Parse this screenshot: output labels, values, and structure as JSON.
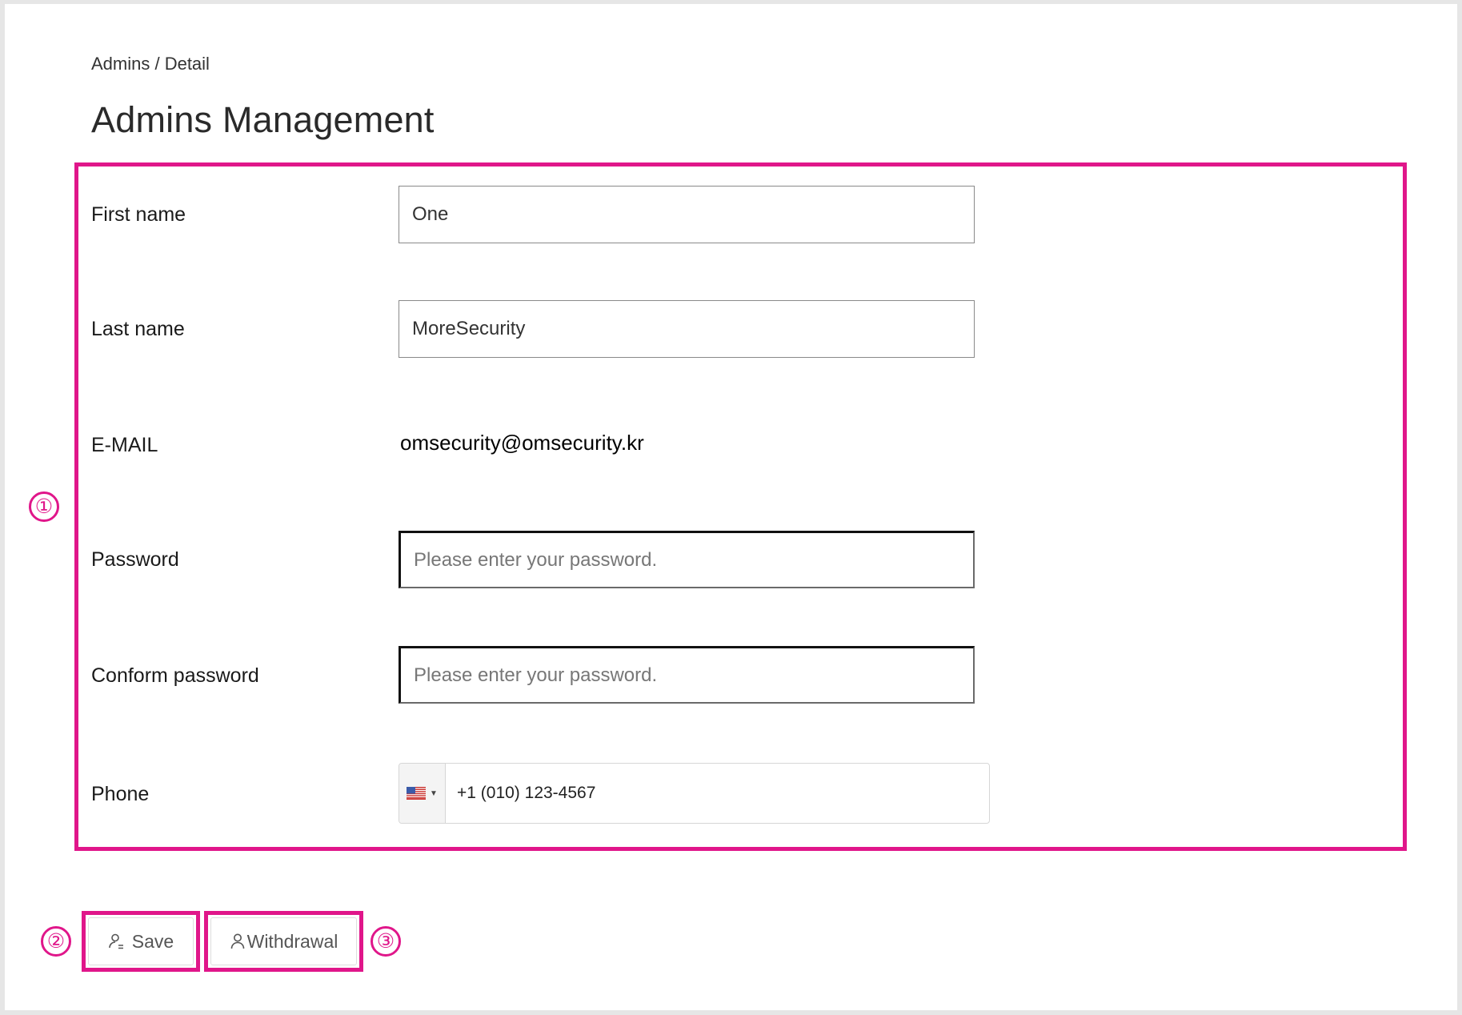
{
  "breadcrumb": "Admins / Detail",
  "page_title": "Admins Management",
  "markers": [
    "①",
    "②",
    "③"
  ],
  "form": {
    "first_name": {
      "label": "First name",
      "value": "One"
    },
    "last_name": {
      "label": "Last name",
      "value": "MoreSecurity"
    },
    "email": {
      "label": "E-MAIL",
      "value": "omsecurity@omsecurity.kr"
    },
    "password": {
      "label": "Password",
      "placeholder": "Please enter your password."
    },
    "confirm_password": {
      "label": "Conform password",
      "placeholder": "Please enter your password."
    },
    "phone": {
      "label": "Phone",
      "value": "+1 (010) 123-4567",
      "country_flag": "us-flag-icon"
    }
  },
  "buttons": {
    "save": {
      "label": "Save",
      "icon": "user-edit-icon"
    },
    "withdrawal": {
      "label": "Withdrawal",
      "icon": "user-icon"
    }
  },
  "colors": {
    "highlight": "#e0168a",
    "frame": "#e6e6e6"
  }
}
